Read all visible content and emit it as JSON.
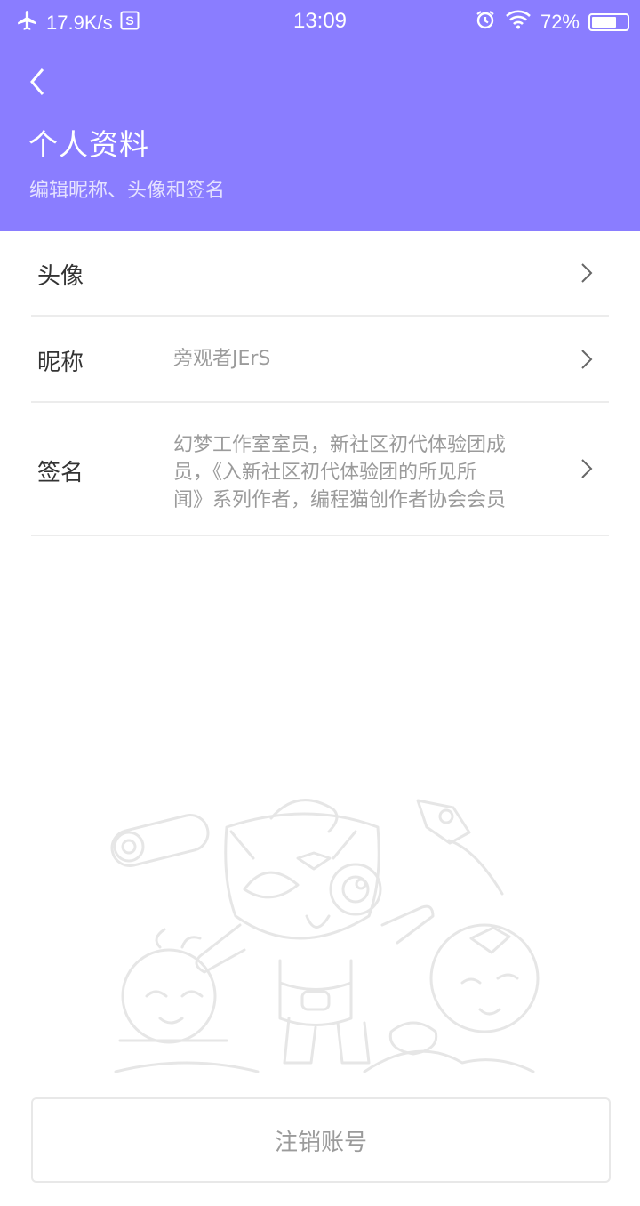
{
  "status_bar": {
    "net_speed": "17.9K/s",
    "time": "13:09",
    "battery_percent": "72%",
    "battery_level": 0.72,
    "icons": [
      "airplane-icon",
      "s-app-icon",
      "alarm-icon",
      "wifi-icon",
      "battery-icon"
    ]
  },
  "header": {
    "title": "个人资料",
    "subtitle": "编辑昵称、头像和签名",
    "background_color": "#8A7DFF"
  },
  "profile_rows": {
    "avatar": {
      "label": "头像"
    },
    "nickname": {
      "label": "昵称",
      "value": "旁观者JErS"
    },
    "signature": {
      "label": "签名",
      "value_lines": [
        "幻梦工作室室员，新社区初代体验团成",
        "员，《入新社区初代体验团的所见所",
        "闻》系列作者，编程猫创作者协会会员"
      ]
    }
  },
  "footer": {
    "logout_label": "注销账号"
  }
}
